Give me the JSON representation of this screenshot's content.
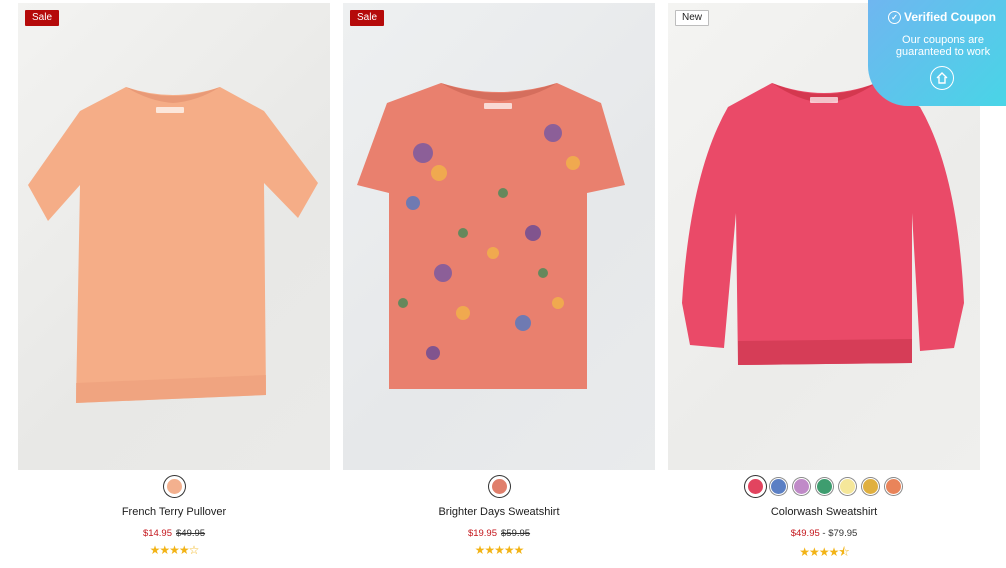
{
  "products": [
    {
      "badge": "Sale",
      "name": "French Terry Pullover",
      "sale_price": "$14.95",
      "original_price": "$49.95",
      "rating": 4,
      "stars_text": "★★★★☆",
      "swatches": [
        "#f3b08e"
      ],
      "garment_color": "#f7b08a"
    },
    {
      "badge": "Sale",
      "name": "Brighter Days Sweatshirt",
      "sale_price": "$19.95",
      "original_price": "$59.95",
      "rating": 5,
      "stars_text": "★★★★★",
      "swatches": [
        "#e07f6c"
      ],
      "garment_color": "#e9806e"
    },
    {
      "badge": "New",
      "name": "Colorwash Sweatshirt",
      "price_range": "$49.95 - $79.95",
      "price_low": "$49.95",
      "price_high": "$79.95",
      "rating": 4.5,
      "stars_text": "★★★★⯪",
      "swatches": [
        "#e2445f",
        "#5b7fc4",
        "#c08ac8",
        "#3e9d6f",
        "#f5e79a",
        "#e0b040",
        "#e9845a"
      ],
      "garment_color": "#ea4a68"
    }
  ],
  "coupon": {
    "title": "Verified Coupon",
    "subtitle": "Our coupons are guaranteed to work"
  }
}
